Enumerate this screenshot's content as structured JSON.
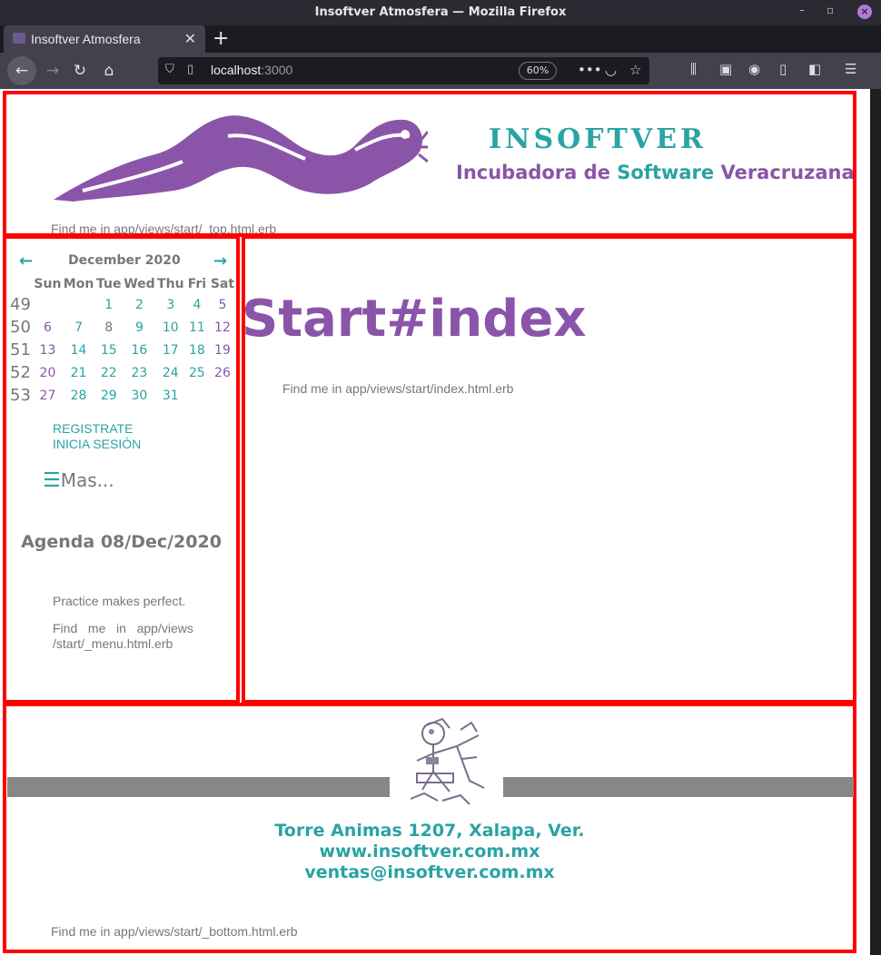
{
  "window": {
    "title": "Insoftver Atmosfera — Mozilla Firefox"
  },
  "tab": {
    "label": "Insoftver Atmosfera"
  },
  "url": {
    "host": "localhost",
    "port": ":3000",
    "zoom": "60%"
  },
  "top": {
    "brand_word": "INSOFTVER",
    "brand_sub_1": "Incubadora de ",
    "brand_sub_2": "Software",
    "brand_sub_3": " Veracruzana",
    "findme": "Find me in app/views/start/_top.html.erb"
  },
  "calendar": {
    "month": "December 2020",
    "weekdays": [
      "Sun",
      "Mon",
      "Tue",
      "Wed",
      "Thu",
      "Fri",
      "Sat"
    ],
    "weeks": [
      {
        "n": "49",
        "days": [
          "",
          "",
          "1",
          "2",
          "3",
          "4",
          "5"
        ]
      },
      {
        "n": "50",
        "days": [
          "6",
          "7",
          "8",
          "9",
          "10",
          "11",
          "12"
        ]
      },
      {
        "n": "51",
        "days": [
          "13",
          "14",
          "15",
          "16",
          "17",
          "18",
          "19"
        ]
      },
      {
        "n": "52",
        "days": [
          "20",
          "21",
          "22",
          "23",
          "24",
          "25",
          "26"
        ]
      },
      {
        "n": "53",
        "days": [
          "27",
          "28",
          "29",
          "30",
          "31",
          "",
          ""
        ]
      }
    ],
    "today": "8"
  },
  "menu": {
    "register": "REGISTRATE",
    "login": "INICIA SESIÓN",
    "more": "Mas...",
    "agenda": "Agenda 08/Dec/2020",
    "quote": "Practice makes perfect.",
    "findme_1": "Find   me   in   app/views",
    "findme_2": "/start/_menu.html.erb"
  },
  "main": {
    "title": "Start#index",
    "findme": "Find me in app/views/start/index.html.erb"
  },
  "bottom": {
    "address": "Torre Animas 1207, Xalapa, Ver.",
    "web": "www.insoftver.com.mx",
    "email": "ventas@insoftver.com.mx",
    "findme": "Find me in app/views/start/_bottom.html.erb"
  },
  "colors": {
    "teal": "#2aa3a3",
    "purple": "#8a55a8",
    "frame_red": "#ff0000"
  }
}
